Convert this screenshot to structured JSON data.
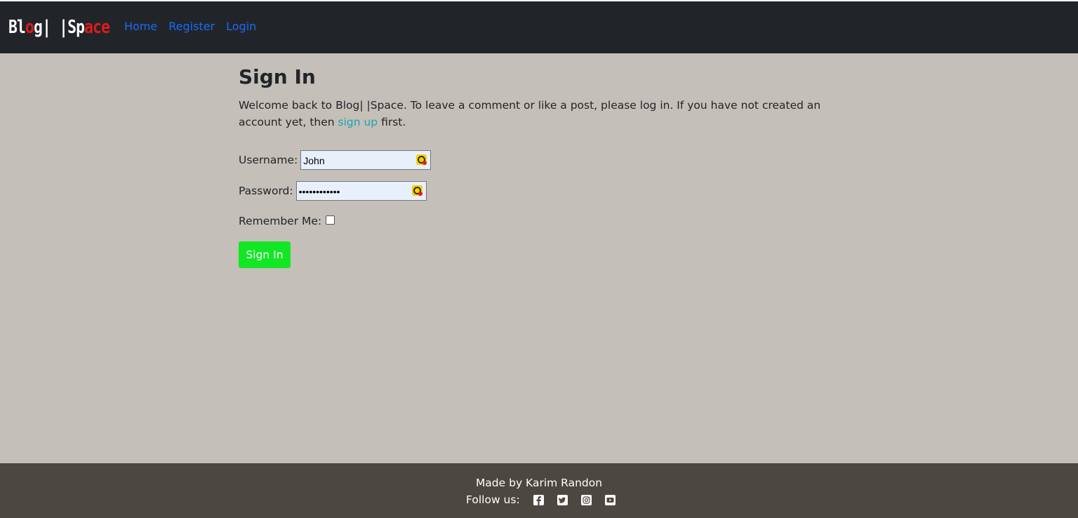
{
  "brand": {
    "part1": "Bl",
    "part2": "o",
    "part3": "g| |Sp",
    "part4": "a",
    "part5": "c",
    "part6": "e"
  },
  "nav": {
    "home": "Home",
    "register": "Register",
    "login": "Login"
  },
  "page": {
    "title": "Sign In",
    "intro_before": "Welcome back to Blog| |Space. To leave a comment or like a post, please log in. If you have not created an account yet, then ",
    "intro_link": "sign up",
    "intro_after": " first."
  },
  "form": {
    "username_label": "Username:",
    "username_value": "John",
    "password_label": "Password:",
    "password_value": "••••••••••••",
    "remember_label": "Remember Me:",
    "submit_label": "Sign In"
  },
  "footer": {
    "credit": "Made by Karim Randon",
    "follow_label": "Follow us:",
    "social_icons": [
      "facebook-icon",
      "twitter-icon",
      "instagram-icon",
      "youtube-icon"
    ]
  },
  "colors": {
    "navbar": "#212529",
    "page_bg": "#c4bfb8",
    "footer_bg": "#4c4741",
    "link": "#1a6af5",
    "signup_link": "#1aa6b0",
    "button": "#13e725",
    "brand_accent": "#e01b1b"
  }
}
